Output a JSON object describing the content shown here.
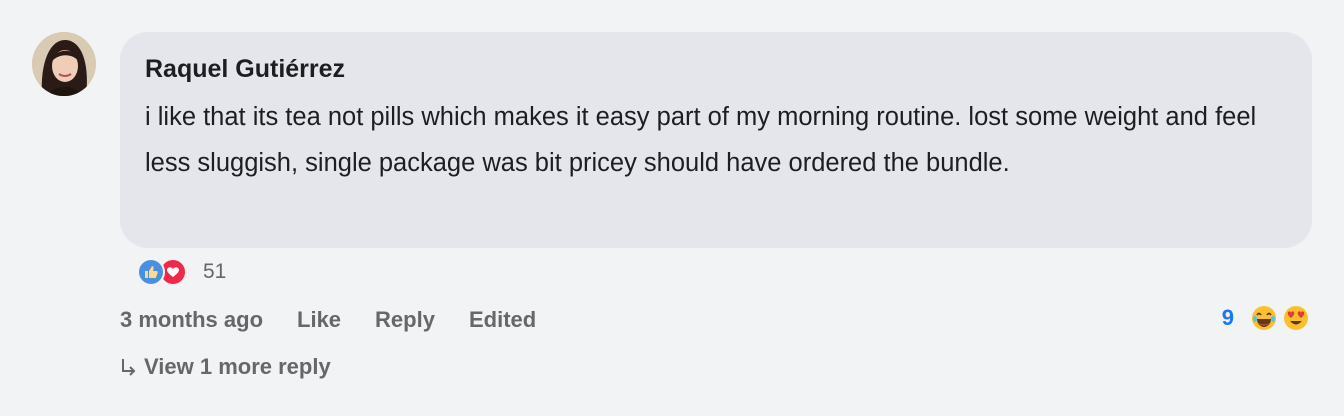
{
  "comment": {
    "author": "Raquel Gutiérrez",
    "text": "i like that its tea not pills which makes it easy part of my morning routine. lost some weight and feel less sluggish, single package was bit pricey should have ordered the bundle.",
    "reactions": {
      "icons": [
        "thumbs-up-icon",
        "heart-icon"
      ],
      "count": "51"
    },
    "actions": {
      "timestamp": "3 months ago",
      "like_label": "Like",
      "reply_label": "Reply",
      "edited_label": "Edited"
    },
    "emoji_reactions": {
      "count": "9",
      "icons": [
        "laughing-emoji-icon",
        "heart-eyes-emoji-icon"
      ]
    },
    "view_replies_label": "View 1 more reply"
  },
  "colors": {
    "background": "#f2f3f5",
    "bubble": "#e4e6eb",
    "accent": "#1877f2",
    "muted": "#65676b"
  }
}
